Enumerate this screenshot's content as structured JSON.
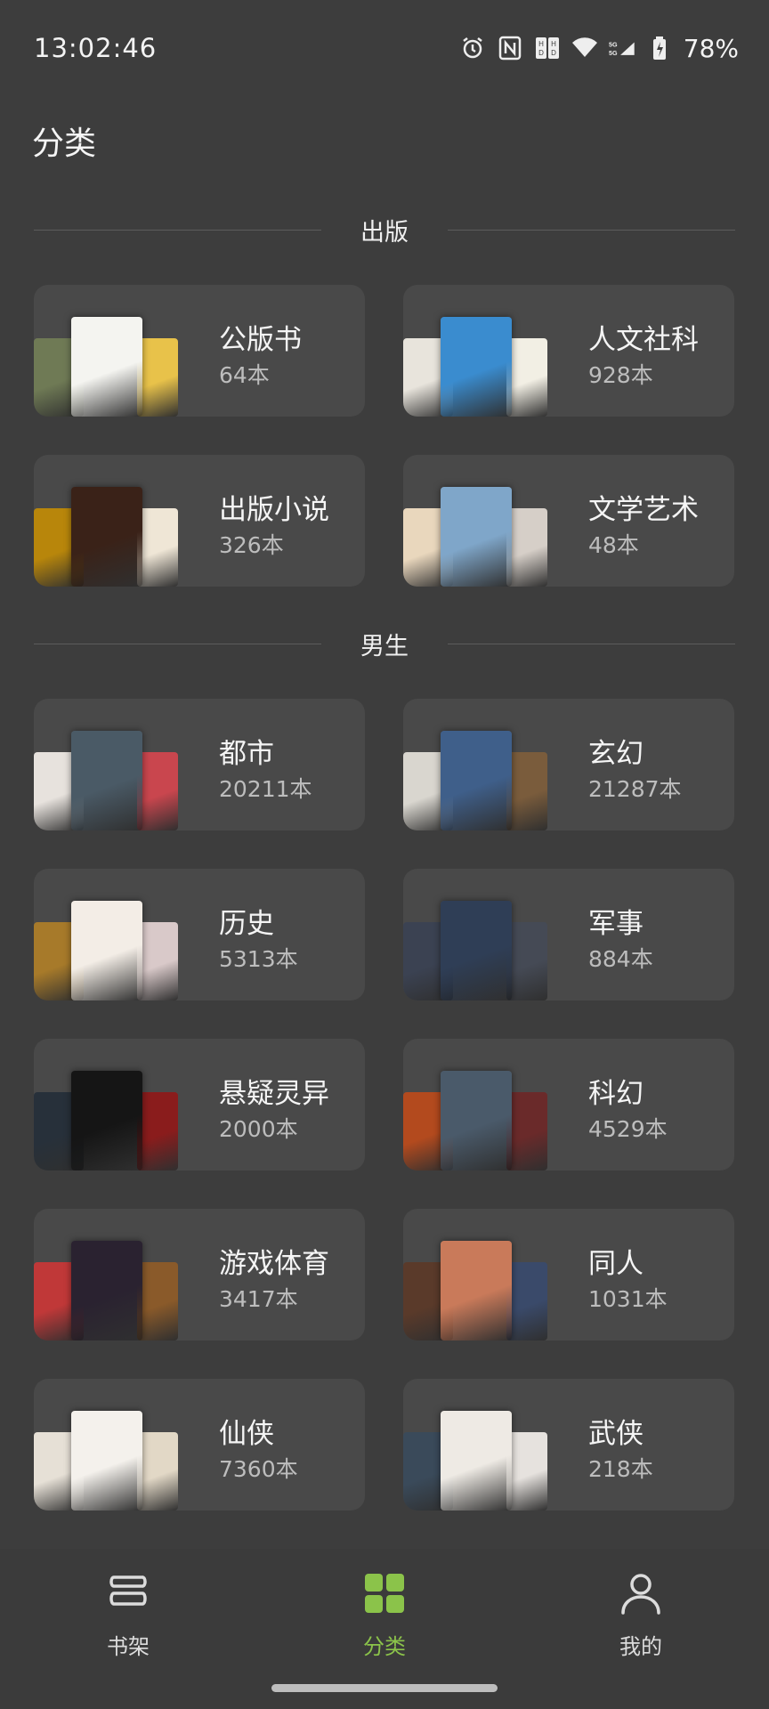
{
  "status_bar": {
    "time": "13:02:46",
    "battery": "78%"
  },
  "page": {
    "title": "分类"
  },
  "sections": [
    {
      "title": "出版",
      "items": [
        {
          "name": "公版书",
          "count": "64本",
          "covers": [
            "#6f7a55",
            "#f4f4f0",
            "#e8c24a"
          ]
        },
        {
          "name": "人文社科",
          "count": "928本",
          "covers": [
            "#e8e4dc",
            "#3a8ccf",
            "#f2efe4"
          ]
        },
        {
          "name": "出版小说",
          "count": "326本",
          "covers": [
            "#b8860b",
            "#3a2218",
            "#efe6d6"
          ]
        },
        {
          "name": "文学艺术",
          "count": "48本",
          "covers": [
            "#e9d7bd",
            "#7fa6c9",
            "#d6cfc8"
          ]
        }
      ]
    },
    {
      "title": "男生",
      "items": [
        {
          "name": "都市",
          "count": "20211本",
          "covers": [
            "#e7e2dd",
            "#4a5a66",
            "#c9464e"
          ]
        },
        {
          "name": "玄幻",
          "count": "21287本",
          "covers": [
            "#d9d6cf",
            "#3f5f8a",
            "#7a5c3c"
          ]
        },
        {
          "name": "历史",
          "count": "5313本",
          "covers": [
            "#a77a2a",
            "#f3ede6",
            "#d9c9c9"
          ]
        },
        {
          "name": "军事",
          "count": "884本",
          "covers": [
            "#3b4252",
            "#2f3e56",
            "#454a55"
          ]
        },
        {
          "name": "悬疑灵异",
          "count": "2000本",
          "covers": [
            "#27303a",
            "#151515",
            "#8a1c1c"
          ]
        },
        {
          "name": "科幻",
          "count": "4529本",
          "covers": [
            "#b34a1e",
            "#4a5a6a",
            "#6a2a2a"
          ]
        },
        {
          "name": "游戏体育",
          "count": "3417本",
          "covers": [
            "#c03838",
            "#2a2230",
            "#8a5a2a"
          ]
        },
        {
          "name": "同人",
          "count": "1031本",
          "covers": [
            "#5a3a2a",
            "#c97a5a",
            "#3a4a6a"
          ]
        },
        {
          "name": "仙侠",
          "count": "7360本",
          "covers": [
            "#e6e0d6",
            "#f4f1ec",
            "#e2d8c6"
          ]
        },
        {
          "name": "武侠",
          "count": "218本",
          "covers": [
            "#3a4a5a",
            "#eeeae4",
            "#e6e2de"
          ]
        }
      ]
    }
  ],
  "bottom_nav": [
    {
      "label": "书架",
      "icon": "bookshelf-icon",
      "active": false
    },
    {
      "label": "分类",
      "icon": "category-grid-icon",
      "active": true
    },
    {
      "label": "我的",
      "icon": "profile-icon",
      "active": false
    }
  ],
  "colors": {
    "accent": "#8bc34a",
    "background": "#3d3d3d",
    "card": "#494949"
  }
}
